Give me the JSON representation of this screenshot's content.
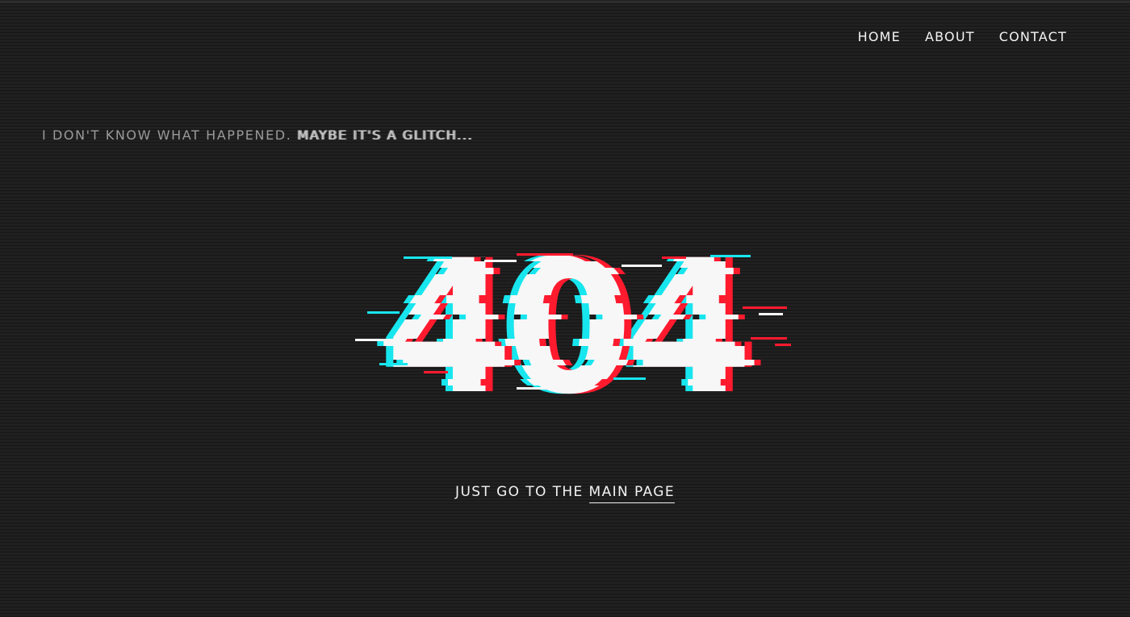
{
  "nav": {
    "items": [
      {
        "label": "HOME"
      },
      {
        "label": "ABOUT"
      },
      {
        "label": "CONTACT"
      }
    ]
  },
  "tagline": {
    "plain": "I DON'T KNOW WHAT HAPPENED.",
    "glitched": "MAYBE IT'S A GLITCH..."
  },
  "error": {
    "code": "404"
  },
  "cta": {
    "prefix": "JUST GO TO THE",
    "link": "MAIN PAGE"
  },
  "colors": {
    "background": "#1c1c1c",
    "text": "#f4f4f4",
    "muted": "#9a9a9a",
    "glitch_red": "#ff1a2e",
    "glitch_cyan": "#17e6ee"
  }
}
